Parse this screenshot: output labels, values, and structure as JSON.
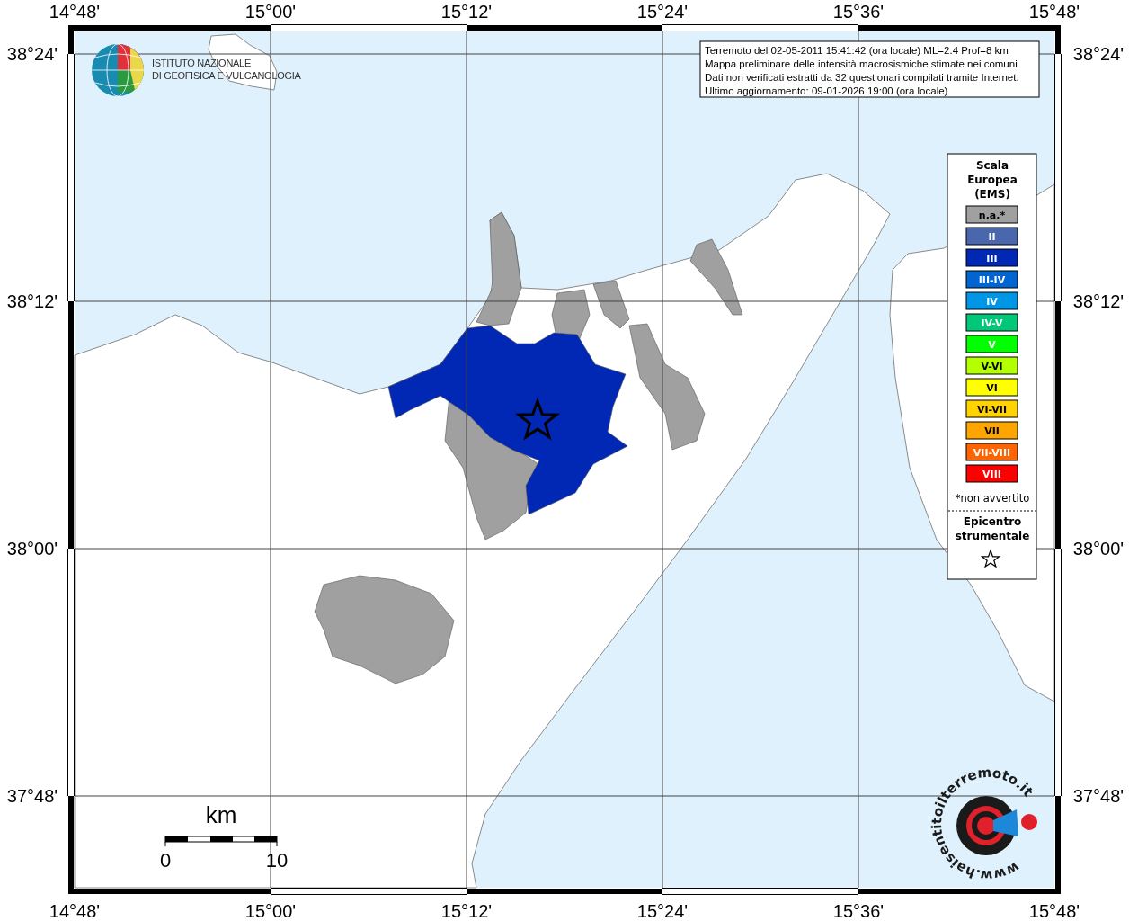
{
  "map": {
    "top_ticks": [
      "14°48'",
      "15°00'",
      "15°12'",
      "15°24'",
      "15°36'",
      "15°48'"
    ],
    "bottom_ticks": [
      "14°48'",
      "15°00'",
      "15°12'",
      "15°24'",
      "15°36'",
      "15°48'"
    ],
    "left_ticks": [
      "38°24'",
      "38°12'",
      "38°00'",
      "37°48'"
    ],
    "right_ticks": [
      "38°24'",
      "38°12'",
      "38°00'",
      "37°48'"
    ],
    "municipalities": [
      {
        "color": "#a0a0a0"
      },
      {
        "color": "#a0a0a0"
      },
      {
        "color": "#a0a0a0"
      },
      {
        "color": "#a0a0a0"
      },
      {
        "color": "#a0a0a0"
      },
      {
        "color": "#a0a0a0"
      },
      {
        "color": "#a0a0a0"
      },
      {
        "color": "#0028b4"
      }
    ]
  },
  "info_box": {
    "lines": [
      "Terremoto del 02-05-2011 15:41:42 (ora locale) ML=2.4 Prof=8 km",
      "Mappa preliminare delle intensità macrosismiche stimate nei comuni",
      "Dati non verificati estratti da 32 questionari compilati tramite Internet.",
      "Ultimo aggiornamento: 09-01-2026 19:00 (ora locale)"
    ]
  },
  "legend": {
    "title": [
      "Scala",
      "Europea",
      "(EMS)"
    ],
    "items": [
      {
        "label": "n.a.*",
        "color": "#a0a0a0"
      },
      {
        "label": "II",
        "color": "#4a66ad"
      },
      {
        "label": "III",
        "color": "#0028b4"
      },
      {
        "label": "III-IV",
        "color": "#0064d2"
      },
      {
        "label": "IV",
        "color": "#0096e6"
      },
      {
        "label": "IV-V",
        "color": "#00c878"
      },
      {
        "label": "V",
        "color": "#00ff00"
      },
      {
        "label": "V-VI",
        "color": "#b4ff00"
      },
      {
        "label": "VI",
        "color": "#ffff00"
      },
      {
        "label": "VI-VII",
        "color": "#ffd200"
      },
      {
        "label": "VII",
        "color": "#ffa500"
      },
      {
        "label": "VII-VIII",
        "color": "#ff6400"
      },
      {
        "label": "VIII",
        "color": "#ff0000"
      }
    ],
    "note": "*non avvertito",
    "epicenter_label": [
      "Epicentro",
      "strumentale"
    ]
  },
  "scale_bar": {
    "unit": "km",
    "labels": [
      "0",
      "10"
    ]
  },
  "logos": {
    "institute": [
      "ISTITUTO NAZIONALE",
      "DI GEOFISICA E VULCANOLOGIA"
    ],
    "website": "www.haisentitoilterremoto.it"
  }
}
